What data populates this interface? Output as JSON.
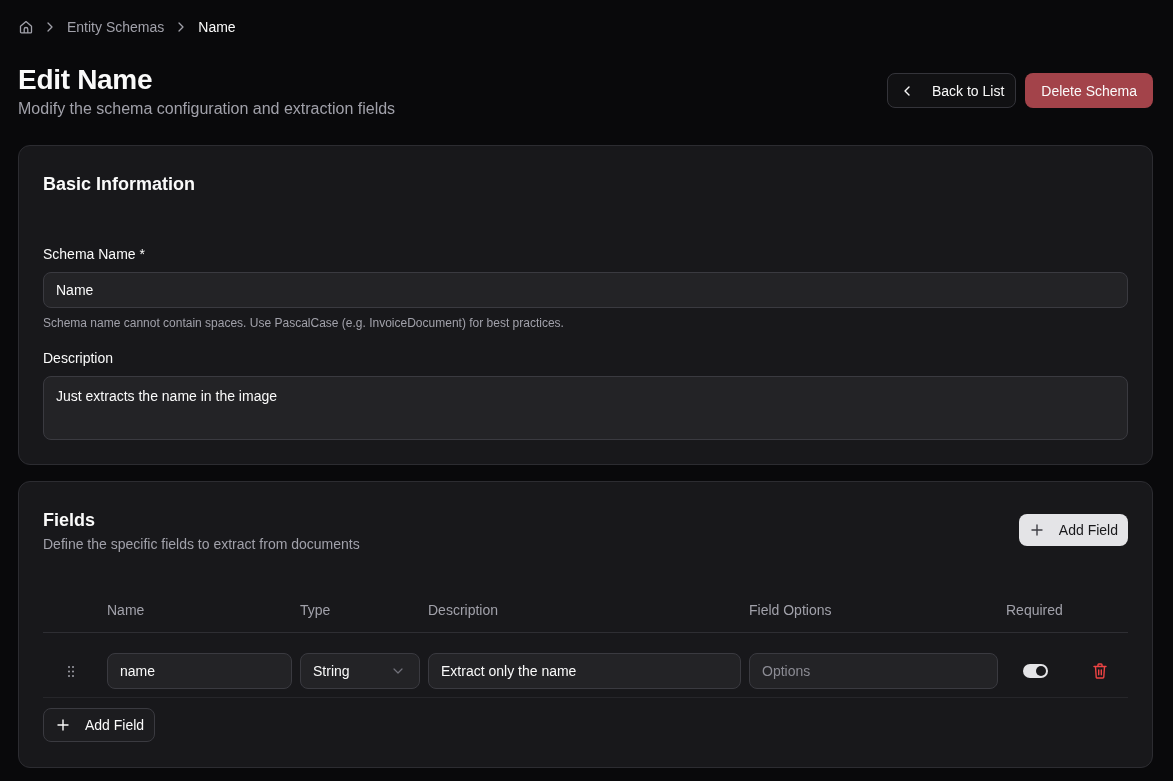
{
  "breadcrumb": [
    {
      "label": "Entity Schemas",
      "current": false
    },
    {
      "label": "Name",
      "current": true
    }
  ],
  "header": {
    "title": "Edit Name",
    "subtitle": "Modify the schema configuration and extraction fields",
    "buttons": [
      {
        "label": "Back to List",
        "kind": "back"
      },
      {
        "label": "Delete Schema",
        "kind": "danger"
      }
    ]
  },
  "basic_information": {
    "title": "Basic Information",
    "fields": [
      {
        "kind": "input",
        "label": "Schema Name *",
        "value": "Name",
        "help": "Schema name cannot contain spaces. Use PascalCase (e.g. InvoiceDocument) for best practices."
      },
      {
        "kind": "textarea",
        "label": "Description",
        "value": "Just extracts the name in the image"
      }
    ]
  },
  "fields_section": {
    "title": "Fields",
    "subtitle": "Define the specific fields to extract from documents",
    "add_button": "Add Field",
    "table": {
      "columns": [
        "Name",
        "Type",
        "Description",
        "Field Options",
        "Required"
      ],
      "rows": [
        {
          "name": "name",
          "type": "String",
          "description": "Extract only the name",
          "options_placeholder": "Options",
          "required": true
        }
      ]
    },
    "bottom_button": "Add Field"
  }
}
